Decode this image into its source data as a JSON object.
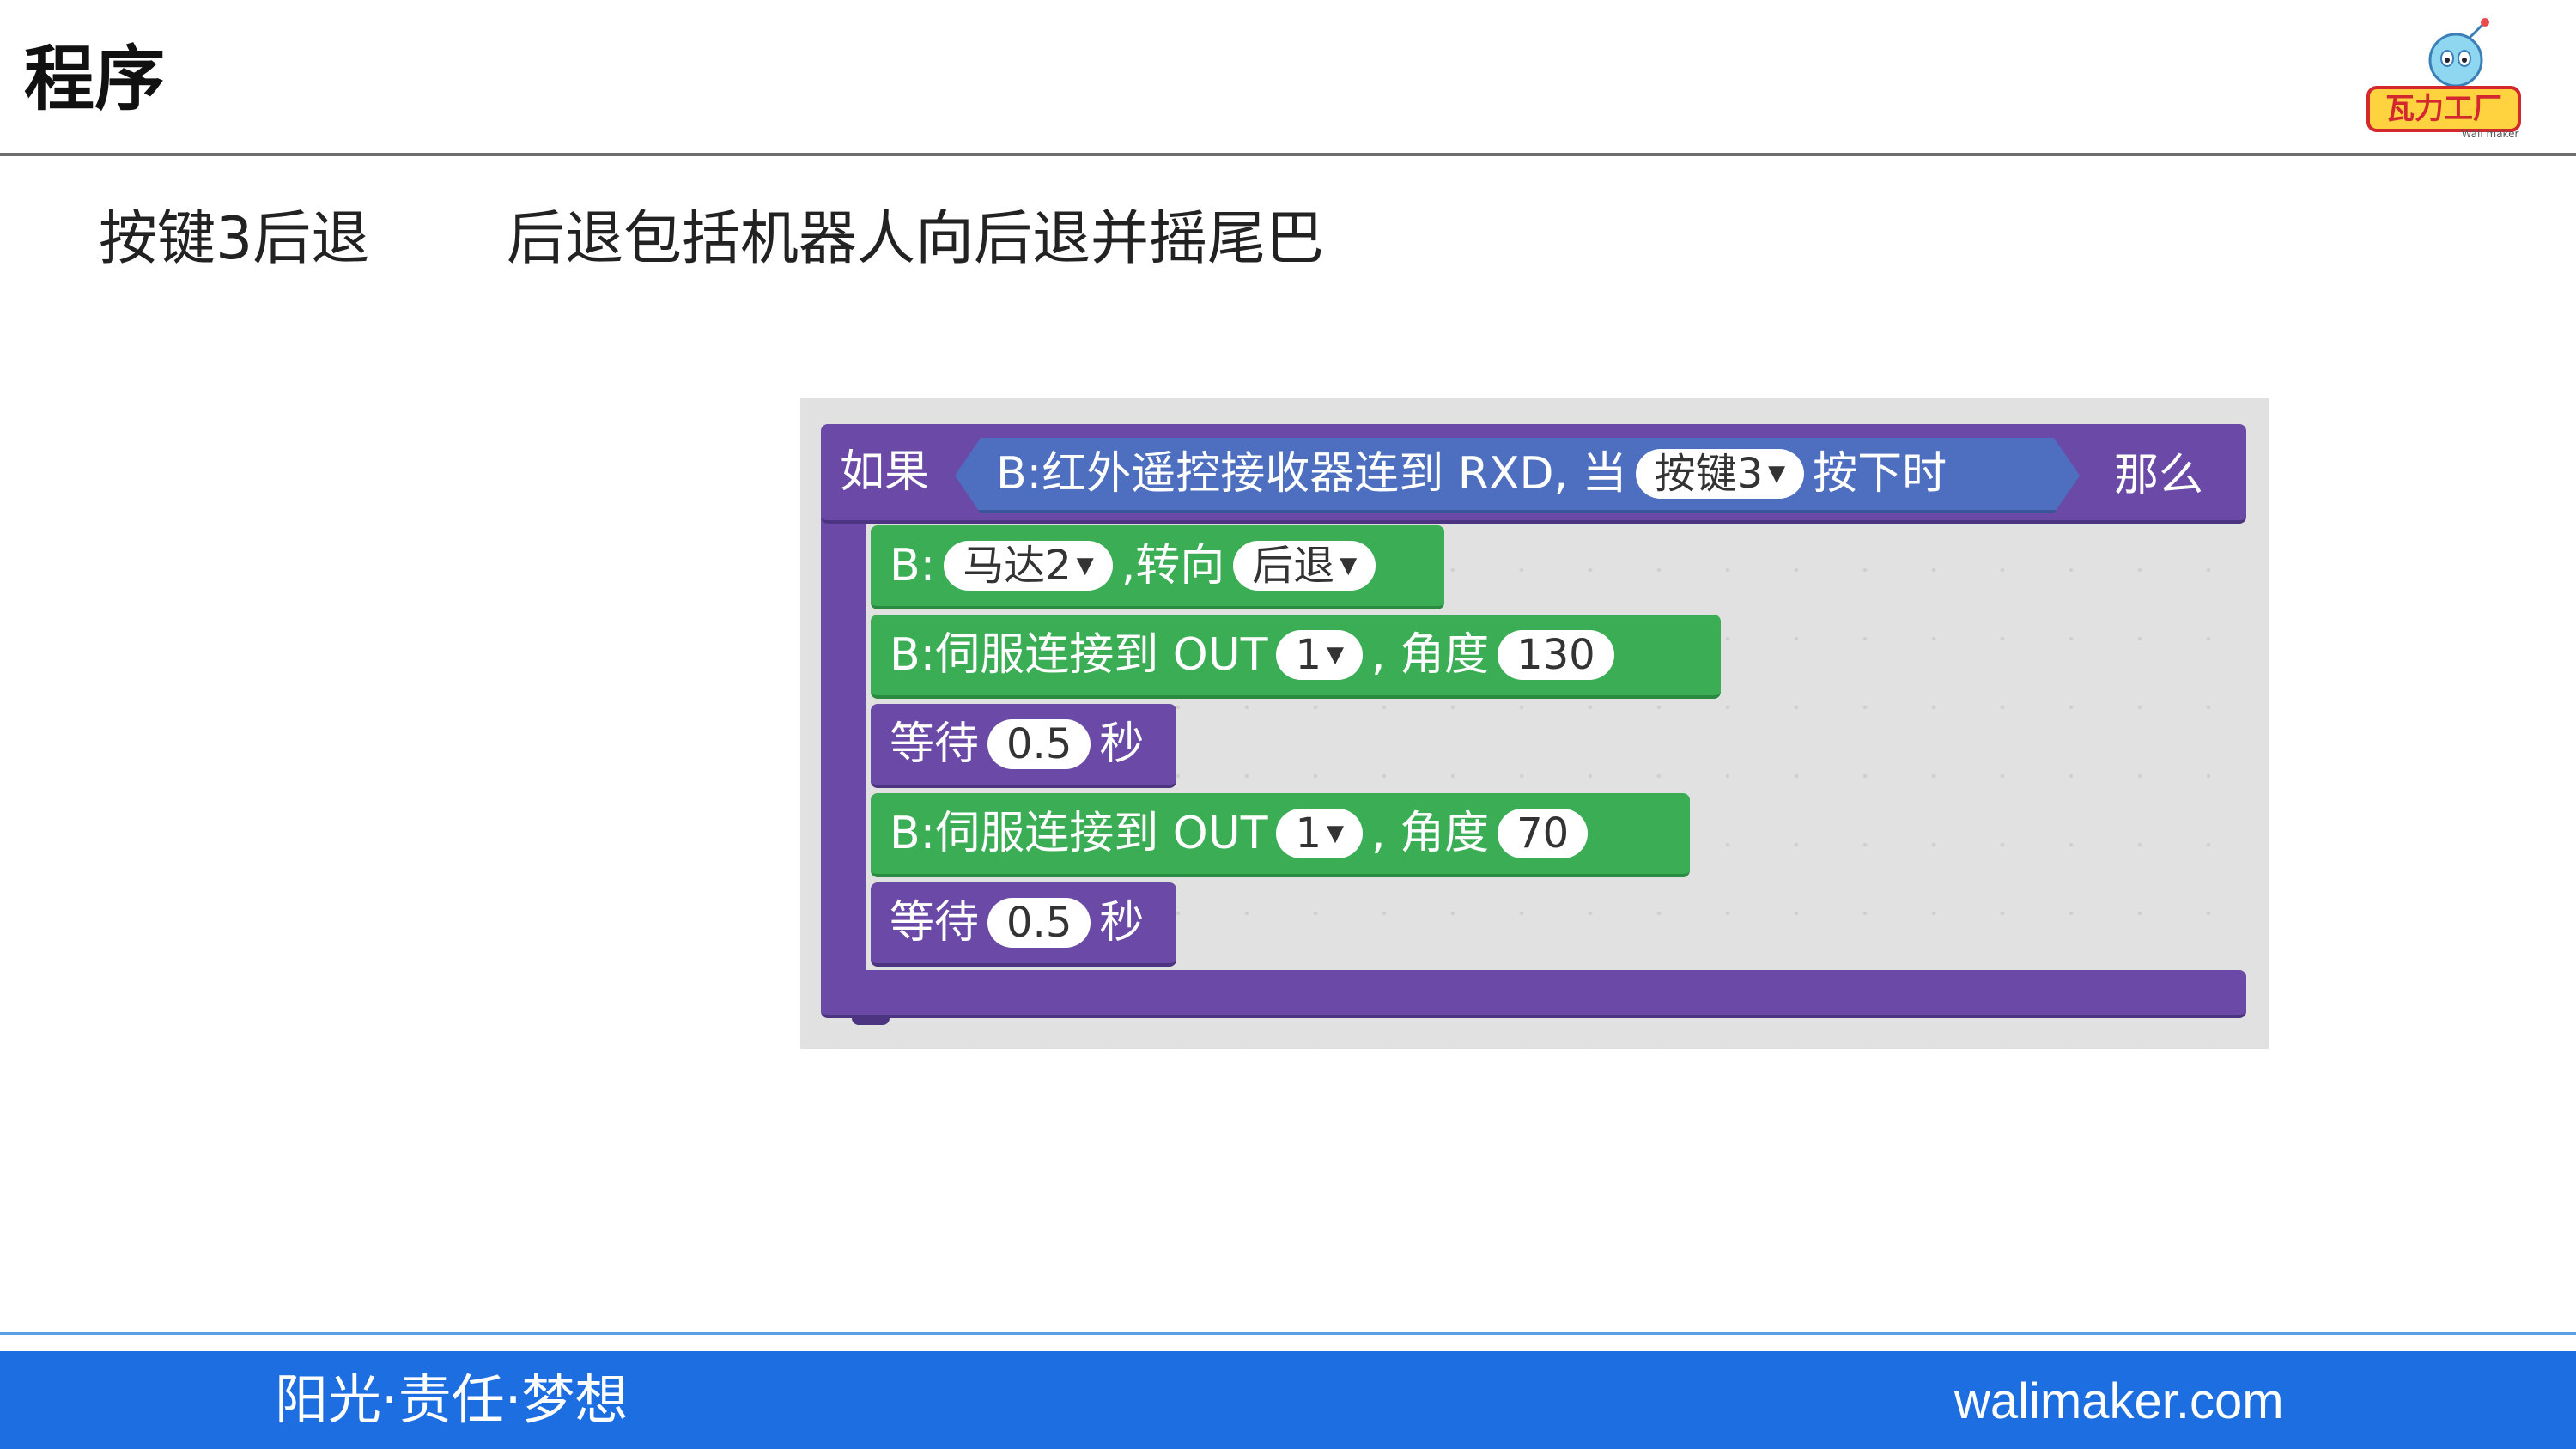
{
  "header": {
    "title": "程序",
    "logo_icon": "walimaker-robot-logo",
    "logo_text": "瓦力工厂",
    "logo_subtext": "Wali maker"
  },
  "subtitle": {
    "left": "按键3后退",
    "right": "后退包括机器人向后退并摇尾巴"
  },
  "program": {
    "if_block": {
      "if_label": "如果",
      "condition_label": "B:红外遥控接收器连到 RXD, 当",
      "condition_key": "按键3",
      "condition_suffix": "按下时",
      "then_label": "那么"
    },
    "motor_block": {
      "prefix": "B:",
      "motor": "马达2",
      "middle": ",转向",
      "direction": "后退"
    },
    "servo_block_1": {
      "label": "B:伺服连接到 OUT",
      "port": "1",
      "angle_label": ", 角度",
      "angle": "130"
    },
    "wait_block_1": {
      "label": "等待",
      "seconds": "0.5",
      "unit": "秒"
    },
    "servo_block_2": {
      "label": "B:伺服连接到 OUT",
      "port": "1",
      "angle_label": ", 角度",
      "angle": "70"
    },
    "wait_block_2": {
      "label": "等待",
      "seconds": "0.5",
      "unit": "秒"
    }
  },
  "footer": {
    "slogan": "阳光·责任·梦想",
    "website": "walimaker.com"
  },
  "colors": {
    "control_purple": "#6a4aa6",
    "motion_green": "#3aad55",
    "sensor_blue": "#4e6fbf",
    "footer_blue": "#1d6ee0"
  }
}
